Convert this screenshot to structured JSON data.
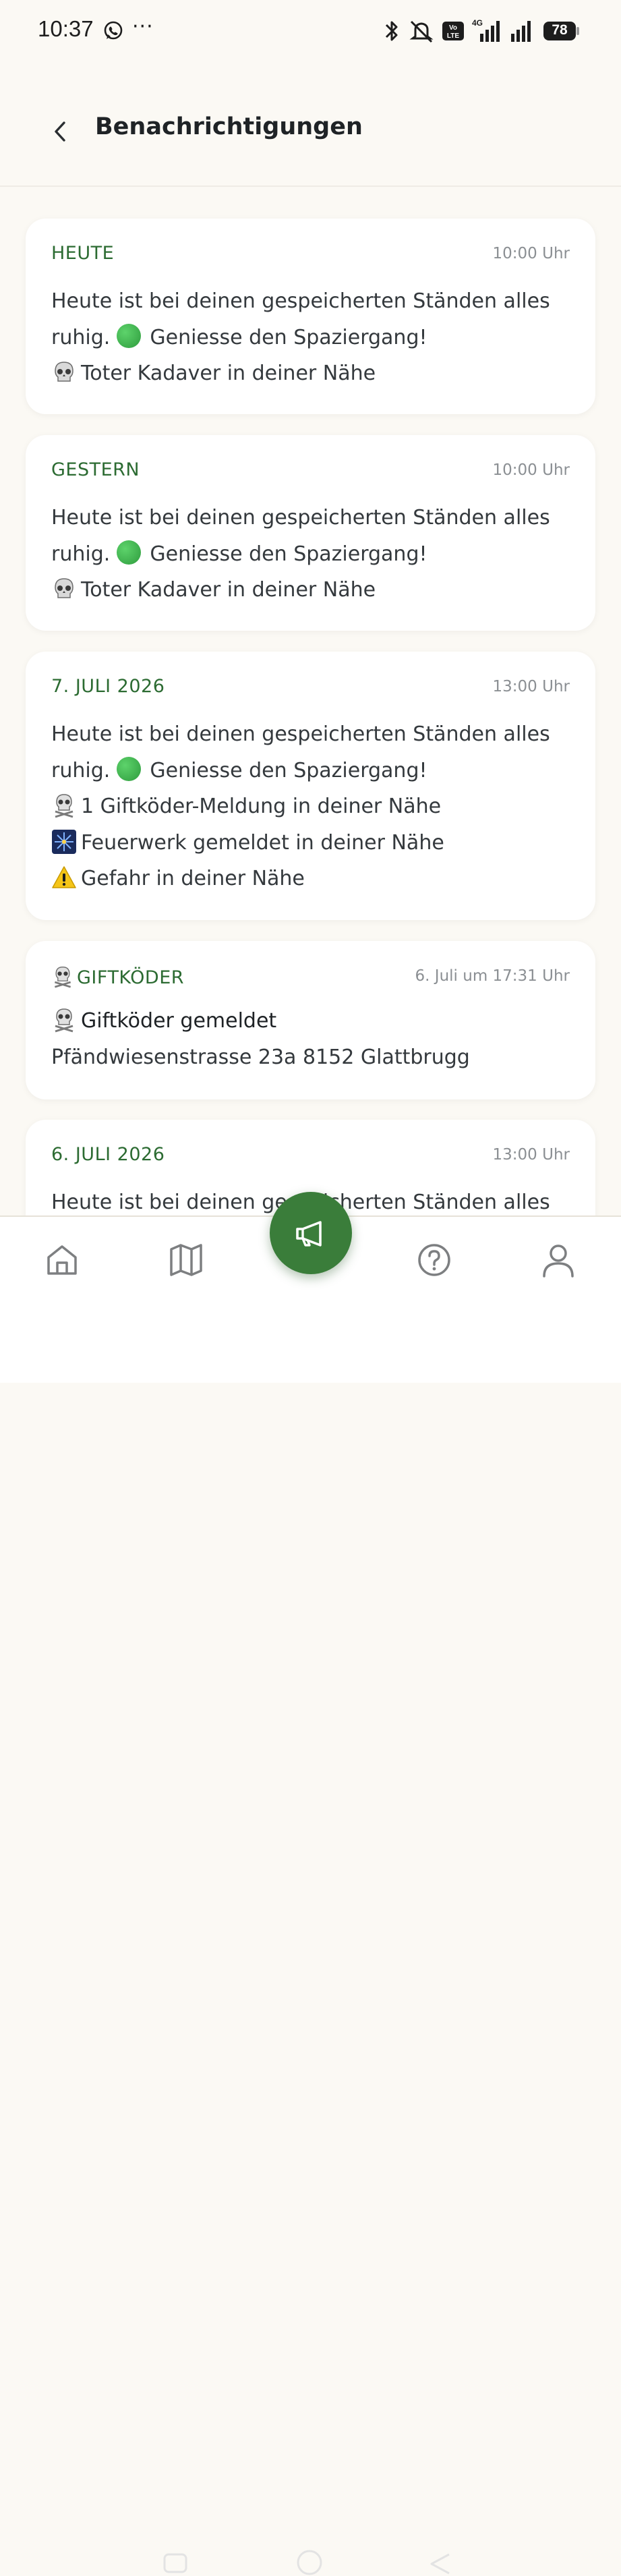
{
  "status_bar": {
    "time": "10:37",
    "more": "···",
    "network": "4G",
    "volte": "Vo LTE",
    "battery": "78"
  },
  "header": {
    "title": "Benachrichtigungen",
    "back_icon": "chevron-left-icon"
  },
  "notifications": [
    {
      "title": "HEUTE",
      "time": "10:00 Uhr",
      "lines": [
        "Heute ist bei deinen gespeicherten Ständen alles",
        "ruhig.",
        "Geniesse den Spaziergang!",
        "Toter Kadaver in deiner Nähe"
      ]
    },
    {
      "title": "GESTERN",
      "time": "10:00 Uhr",
      "lines": [
        "Heute ist bei deinen gespeicherten Ständen alles",
        "ruhig.",
        "Geniesse den Spaziergang!",
        "Toter Kadaver in deiner Nähe"
      ]
    },
    {
      "title": "7. JULI 2026",
      "time": "13:00 Uhr",
      "lines": [
        "Heute ist bei deinen gespeicherten Ständen alles",
        "ruhig.",
        "Geniesse den Spaziergang!",
        "1 Giftköder-Meldung in deiner Nähe",
        "Feuerwerk gemeldet in deiner Nähe",
        "Gefahr in deiner Nähe"
      ]
    },
    {
      "title": "GIFTKÖDER",
      "time": "6. Juli um 17:31 Uhr",
      "lines": [
        "Giftköder gemeldet",
        "Pfändwiesenstrasse 23a 8152 Glattbrugg"
      ]
    },
    {
      "title": "6. JULI 2026",
      "time": "13:00 Uhr",
      "lines": [
        "Heute ist bei deinen gespeicherten Ständen alles"
      ]
    }
  ],
  "bottom_nav": {
    "items": [
      "home-icon",
      "map-icon",
      "megaphone-icon",
      "help-icon",
      "profile-icon"
    ]
  },
  "colors": {
    "accent": "#3a7d3a",
    "title_green": "#2c6b32",
    "background": "#fbf9f4"
  }
}
